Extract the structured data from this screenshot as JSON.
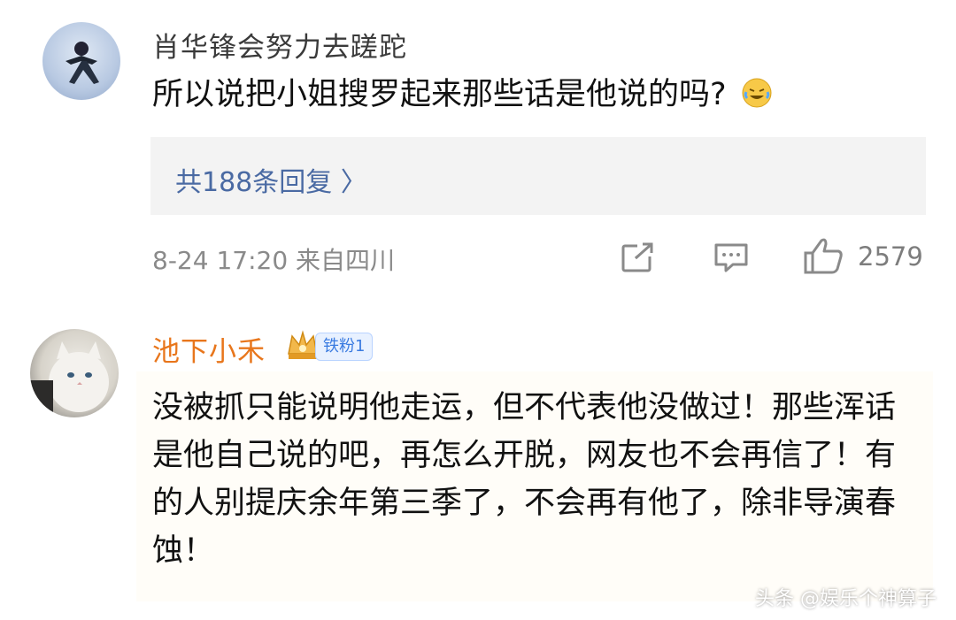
{
  "comments": [
    {
      "username": "肖华锋会努力去蹉跎",
      "text": "所以说把小姐搜罗起来那些话是他说的吗?",
      "emoji": "laughing-crying-emoji",
      "replies_label": "共188条回复 〉",
      "meta": "8-24 17:20  来自四川",
      "likes": "2579"
    },
    {
      "username": "池下小禾",
      "badge": "铁粉1",
      "text": "没被抓只能说明他走运，但不代表他没做过！那些浑话是他自己说的吧，再怎么开脱，网友也不会再信了！有的人别提庆余年第三季了，不会再有他了，除非导演春蚀！"
    }
  ],
  "watermark": "头条 @娱乐个神算子",
  "colors": {
    "username_vip": "#e8761c",
    "link": "#4a6aa3",
    "badge_text": "#3a7be0"
  }
}
